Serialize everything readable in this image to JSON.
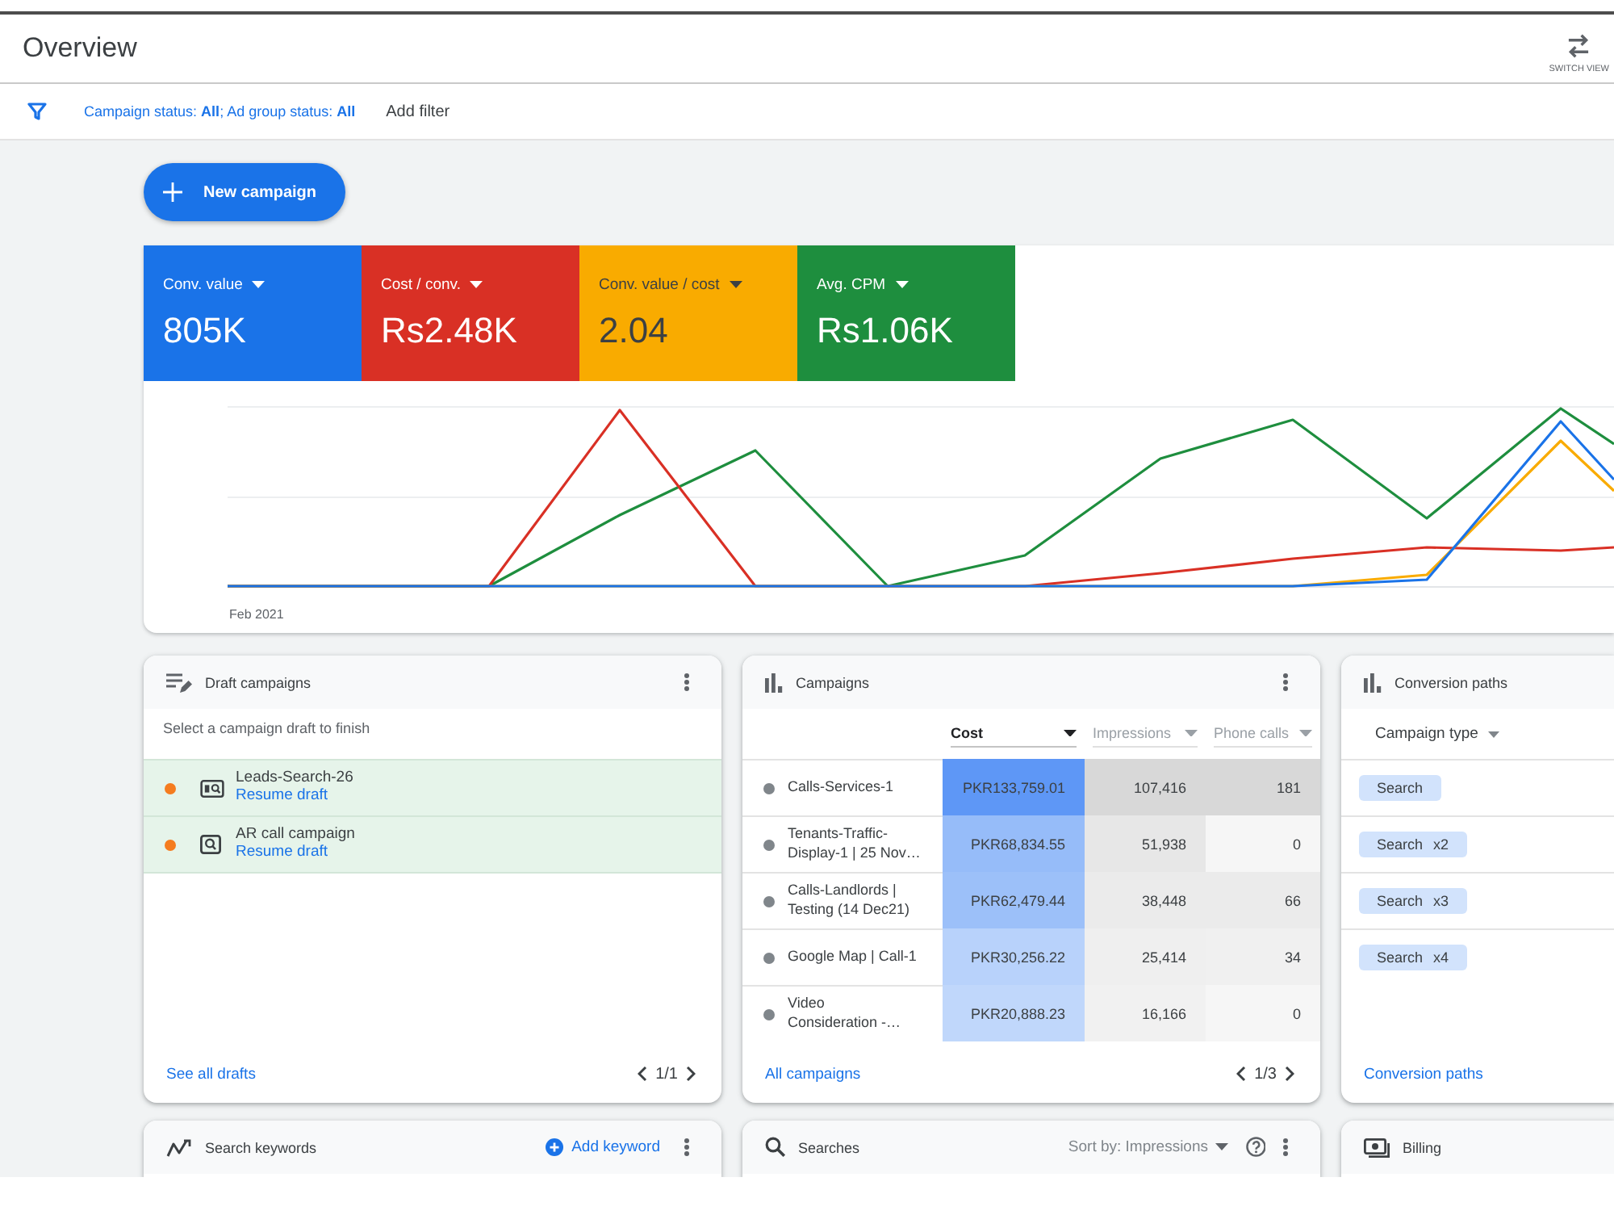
{
  "header": {
    "title": "Overview",
    "switch_view_label": "SWITCH VIEW"
  },
  "filter_bar": {
    "summary": "Campaign status: **All**; Ad group status: **All**",
    "add_filter": "Add filter"
  },
  "new_campaign_button": "New campaign",
  "metrics": [
    {
      "label": "Conv. value",
      "value": "805K",
      "color": "#1a73e8"
    },
    {
      "label": "Cost / conv.",
      "value": "Rs2.48K",
      "color": "#d93025"
    },
    {
      "label": "Conv. value / cost",
      "value": "2.04",
      "color": "#f9ab00"
    },
    {
      "label": "Avg. CPM",
      "value": "Rs1.06K",
      "color": "#1e8e3e"
    }
  ],
  "chart": {
    "start_label": "Feb 2021"
  },
  "draft_campaigns": {
    "title": "Draft campaigns",
    "subtitle": "Select a campaign draft to finish",
    "items": [
      {
        "kind": "wide",
        "name": "Leads-Search-26",
        "action": "Resume draft"
      },
      {
        "kind": "square",
        "name": "AR call campaign",
        "action": "Resume draft"
      }
    ],
    "footer_link": "See all drafts",
    "page": "1/1"
  },
  "campaigns": {
    "title": "Campaigns",
    "columns": [
      {
        "label": "Cost",
        "selected": true
      },
      {
        "label": "Impressions",
        "selected": false
      },
      {
        "label": "Phone calls",
        "selected": false
      }
    ],
    "rows": [
      {
        "name": "Calls-Services-1",
        "cells": [
          "PKR133,759.01",
          "107,416",
          "181"
        ]
      },
      {
        "name": "Tenants-Traffic-Display-1 | 25 Nov…",
        "cells": [
          "PKR68,834.55",
          "51,938",
          "0"
        ]
      },
      {
        "name": "Calls-Landlords | Testing (14 Dec21)",
        "cells": [
          "PKR62,479.44",
          "38,448",
          "66"
        ]
      },
      {
        "name": "Google Map | Call-1",
        "cells": [
          "PKR30,256.22",
          "25,414",
          "34"
        ]
      },
      {
        "name": "Video Consideration -…",
        "cells": [
          "PKR20,888.23",
          "16,166",
          "0"
        ]
      }
    ],
    "footer_link": "All campaigns",
    "page": "1/3"
  },
  "conversion_paths": {
    "title": "Conversion paths",
    "dimension": "Campaign type",
    "paths": [
      {
        "label": "Search"
      },
      {
        "label": "Search",
        "count": "x2"
      },
      {
        "label": "Search",
        "count": "x3"
      },
      {
        "label": "Search",
        "count": "x4"
      }
    ],
    "footer_link": "Conversion paths"
  },
  "bottom_cards": [
    {
      "kind": "keywords",
      "title": "Search keywords",
      "action": "Add keyword"
    },
    {
      "kind": "searches",
      "title": "Searches",
      "sort": "Sort by: Impressions"
    },
    {
      "kind": "billing",
      "title": "Billing"
    }
  ]
}
